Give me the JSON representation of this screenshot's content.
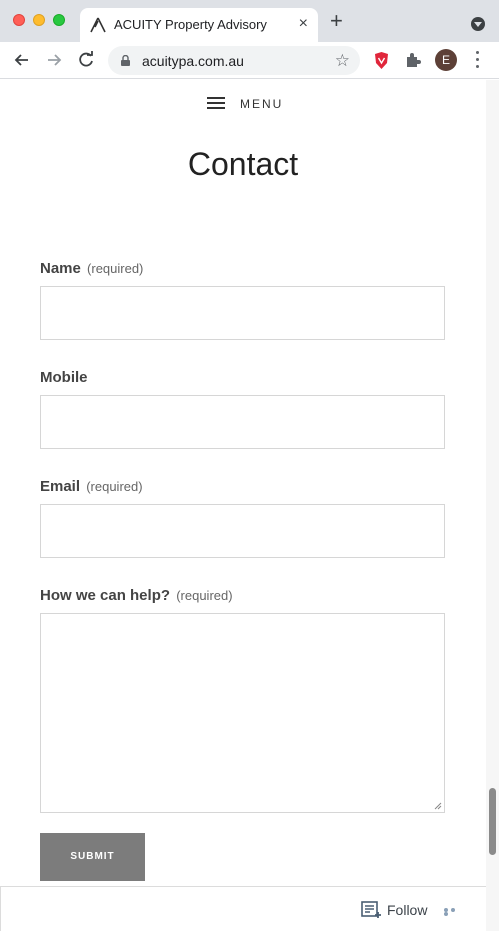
{
  "browser": {
    "tab_title": "ACUITY Property Advisory",
    "tab_close": "×",
    "new_tab": "+",
    "url": "acuitypa.com.au",
    "star": "☆",
    "avatar_letter": "E"
  },
  "header": {
    "menu_label": "MENU"
  },
  "page": {
    "title": "Contact"
  },
  "form": {
    "fields": [
      {
        "label": "Name",
        "required_note": "(required)",
        "value": ""
      },
      {
        "label": "Mobile",
        "required_note": "",
        "value": ""
      },
      {
        "label": "Email",
        "required_note": "(required)",
        "value": ""
      },
      {
        "label": "How we can help?",
        "required_note": "(required)",
        "value": ""
      }
    ],
    "submit_label": "SUBMIT"
  },
  "follow_bar": {
    "follow_label": "Follow"
  },
  "colors": {
    "submit_bg": "#7c7c7c",
    "chrome_bg": "#dee1e6",
    "follow_accent": "#8aa0b7"
  },
  "icons": [
    "acuity-logo-icon",
    "close-icon",
    "plus-icon",
    "back-icon",
    "forward-icon",
    "reload-icon",
    "lock-icon",
    "star-icon",
    "brave-shield-icon",
    "puzzle-icon",
    "kebab-icon",
    "hamburger-icon",
    "reader-follow-icon",
    "more-icon"
  ]
}
